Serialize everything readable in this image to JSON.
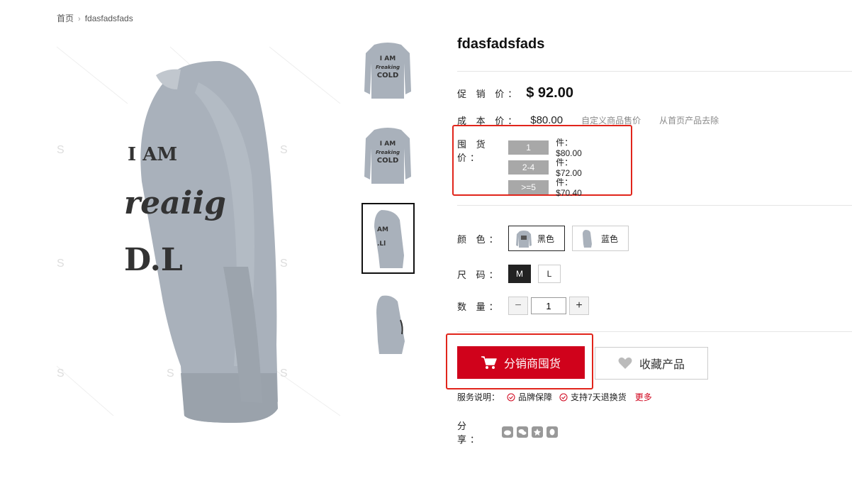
{
  "breadcrumb": {
    "home": "首页",
    "current": "fdasfadsfads"
  },
  "product": {
    "title": "fdasfadsfads",
    "promo_label": "促 销 价：",
    "promo_price": "$ 92.00",
    "cost_label": "成 本 价：",
    "cost_price": "$80.00",
    "custom_price_link": "自定义商品售价",
    "remove_link": "从首页产品去除",
    "bulk_label": "囤 货 价：",
    "bulk_tiers": [
      {
        "qty": "1",
        "price": "件：$80.00"
      },
      {
        "qty": "2-4",
        "price": "件：$72.00"
      },
      {
        "qty": ">=5",
        "price": "件：$70.40"
      }
    ]
  },
  "options": {
    "color_label": "颜 色：",
    "colors": [
      "黑色",
      "蓝色"
    ],
    "size_label": "尺 码：",
    "sizes": [
      "M",
      "L"
    ],
    "quantity_label": "数 量：",
    "quantity": "1"
  },
  "actions": {
    "cart_label": "分销商囤货",
    "favorite_label": "收藏产品"
  },
  "service": {
    "label": "服务说明：",
    "items": [
      "品牌保障",
      "支持7天退换货"
    ],
    "more": "更多"
  },
  "share": {
    "label": "分 享：",
    "icons": [
      "weibo-icon",
      "wechat-icon",
      "qzone-icon",
      "qq-icon"
    ]
  },
  "colors": {
    "accent": "#d0021b",
    "highlight_border": "#e1251b",
    "tier_bg": "#a8a8a8"
  }
}
